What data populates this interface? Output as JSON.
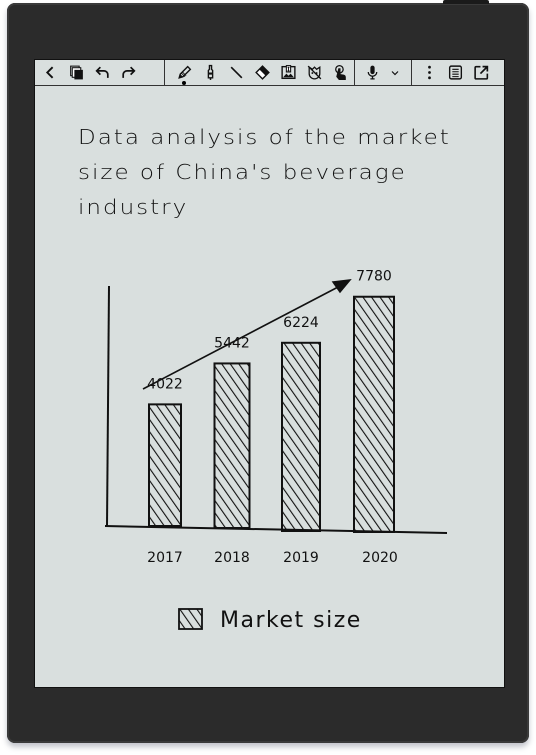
{
  "toolbar": {
    "groups": [
      {
        "name": "navigation",
        "items": [
          {
            "icon": "back-icon",
            "label": "Back"
          },
          {
            "icon": "pages-icon",
            "label": "Pages"
          },
          {
            "icon": "undo-icon",
            "label": "Undo"
          },
          {
            "icon": "redo-icon",
            "label": "Redo"
          }
        ]
      },
      {
        "name": "tools",
        "items": [
          {
            "icon": "pencil-icon",
            "label": "Pen",
            "active": true
          },
          {
            "icon": "marker-icon",
            "label": "Marker"
          },
          {
            "icon": "line-icon",
            "label": "Line"
          },
          {
            "icon": "eraser-icon",
            "label": "Eraser"
          },
          {
            "icon": "image-insert-icon",
            "label": "Insert image"
          },
          {
            "icon": "lasso-off-icon",
            "label": "Lasso"
          },
          {
            "icon": "touch-icon",
            "label": "Touch"
          }
        ]
      },
      {
        "name": "voice",
        "items": [
          {
            "icon": "microphone-icon",
            "label": "Voice"
          },
          {
            "icon": "chevron-down-icon",
            "label": "More voice options"
          }
        ]
      },
      {
        "name": "more",
        "items": [
          {
            "icon": "more-vertical-icon",
            "label": "More"
          },
          {
            "icon": "notes-icon",
            "label": "Note list"
          },
          {
            "icon": "share-icon",
            "label": "Export"
          }
        ]
      }
    ]
  },
  "note": {
    "title_lines": [
      "Data analysis of the market",
      "size of China's beverage",
      "industry"
    ]
  },
  "chart_data": {
    "type": "bar",
    "title": "Data analysis of the market size of China's beverage industry",
    "categories": [
      "2017",
      "2018",
      "2019",
      "2020"
    ],
    "series": [
      {
        "name": "Market size",
        "values": [
          4022,
          5442,
          6224,
          7780
        ]
      }
    ],
    "data_labels": [
      "4022",
      "5442",
      "6224",
      "7780"
    ],
    "xlabel": "",
    "ylabel": "",
    "ylim": [
      0,
      9000
    ],
    "legend": {
      "entries": [
        "Market size"
      ],
      "placement": "bottom-center"
    },
    "annotations": [
      "upward trend arrow"
    ],
    "grid": false,
    "style": "hand-drawn hatched"
  }
}
